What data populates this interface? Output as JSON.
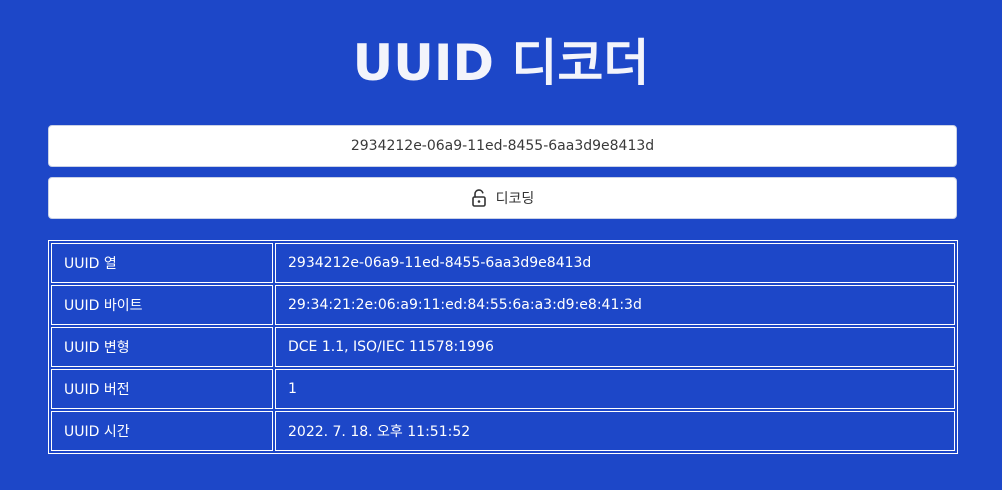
{
  "page": {
    "title": "UUID 디코더"
  },
  "input": {
    "value": "2934212e-06a9-11ed-8455-6aa3d9e8413d"
  },
  "decode_button": {
    "label": "디코딩",
    "icon": "unlock-icon"
  },
  "results": {
    "rows": [
      {
        "label": "UUID 열",
        "value": "2934212e-06a9-11ed-8455-6aa3d9e8413d"
      },
      {
        "label": "UUID 바이트",
        "value": "29:34:21:2e:06:a9:11:ed:84:55:6a:a3:d9:e8:41:3d"
      },
      {
        "label": "UUID 변형",
        "value": "DCE 1.1, ISO/IEC 11578:1996"
      },
      {
        "label": "UUID 버전",
        "value": "1"
      },
      {
        "label": "UUID 시간",
        "value": "2022. 7. 18. 오후 11:51:52"
      }
    ]
  },
  "colors": {
    "background": "#1d47c8",
    "title": "#f3f4fb",
    "panel": "#ffffff"
  }
}
